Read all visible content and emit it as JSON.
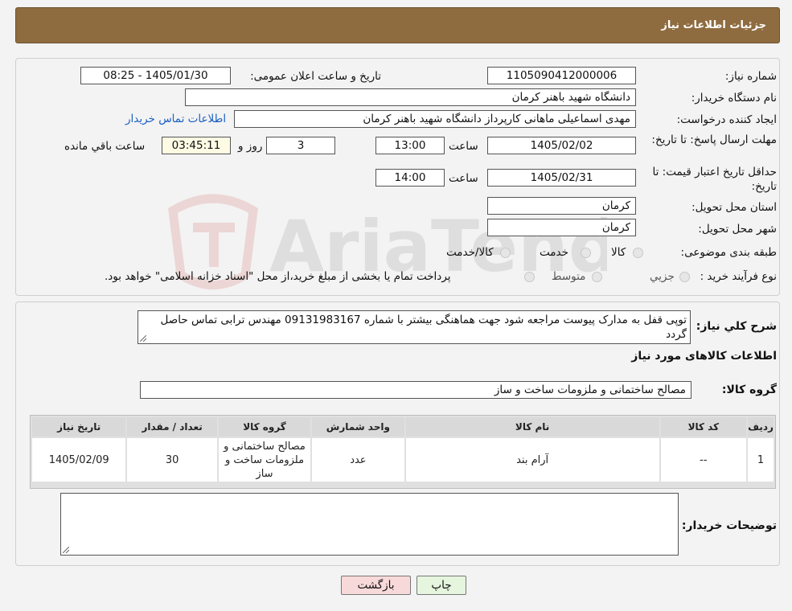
{
  "header": {
    "title": "جزئیات اطلاعات نیاز"
  },
  "form": {
    "need_number_label": "شماره نیاز:",
    "need_number": "1105090412000006",
    "announce_label": "تاریخ و ساعت اعلان عمومی:",
    "announce_value": "1405/01/30 - 08:25",
    "buyer_org_label": "نام دستگاه خریدار:",
    "buyer_org": "دانشگاه شهید باهنر کرمان",
    "creator_label": "ایجاد کننده درخواست:",
    "creator": "مهدی اسماعیلی ماهانی  کارپرداز دانشگاه شهید باهنر کرمان",
    "contact_link": "اطلاعات تماس خریدار",
    "deadline_label": "مهلت ارسال پاسخ: تا تاریخ:",
    "deadline_date": "1405/02/02",
    "time_label": "ساعت",
    "deadline_time": "13:00",
    "days_value": "3",
    "days_label": "روز و",
    "remaining_time": "03:45:11",
    "remaining_label": "ساعت باقي مانده",
    "validity_label": "حداقل تاریخ اعتبار قیمت: تا تاریخ:",
    "validity_date": "1405/02/31",
    "validity_time_label": "ساعت",
    "validity_time": "14:00",
    "province_label": "استان محل تحویل:",
    "province": "کرمان",
    "city_label": "شهر محل تحویل:",
    "city": "کرمان",
    "category_label": "طبقه بندی موضوعی:",
    "category_options": [
      "کالا",
      "خدمت",
      "کالا/خدمت"
    ],
    "process_label": "نوع فرآیند خرید :",
    "process_options": [
      "جزيي",
      "متوسط"
    ],
    "process_note": "پرداخت تمام یا بخشی از مبلغ خرید،از محل \"اسناد خزانه اسلامی\" خواهد بود."
  },
  "description": {
    "label": "شرح كلي نياز:",
    "text": "توپی قفل به مدارک پیوست مراجعه شود جهت هماهنگی بیشتر با شماره 09131983167 مهندس ترابی تماس حاصل گردد"
  },
  "goods": {
    "section_title": "اطلاعات کالاهای مورد نیاز",
    "group_label": "گروه کالا:",
    "group_value": "مصالح ساختمانی و ملزومات ساخت و ساز",
    "columns": [
      "ردیف",
      "کد کالا",
      "نام کالا",
      "واحد شمارش",
      "گروه کالا",
      "تعداد / مقدار",
      "تاریخ نیاز"
    ],
    "rows": [
      {
        "row": "1",
        "code": "--",
        "name": "آرام بند",
        "unit": "عدد",
        "group": "مصالح ساختمانی و ملزومات ساخت و ساز",
        "qty": "30",
        "date": "1405/02/09"
      }
    ]
  },
  "buyer_notes": {
    "label": "توضیحات خریدار:",
    "value": ""
  },
  "buttons": {
    "print": "چاپ",
    "back": "بازگشت"
  },
  "watermark": {
    "text": "AriaTender.neT"
  },
  "colors": {
    "header_bg": "#8f6c40",
    "link": "#1a5fc4",
    "back_btn": "#f8d9d9",
    "print_btn": "#e6f5de"
  }
}
